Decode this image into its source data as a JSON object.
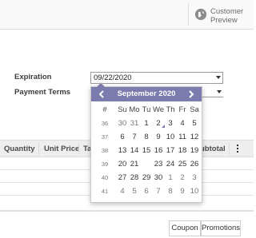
{
  "header": {
    "customer_preview_line1": "Customer",
    "customer_preview_line2": "Preview",
    "icon": "globe-icon"
  },
  "form": {
    "expiration_label": "Expiration",
    "expiration_value": "09/22/2020",
    "payment_terms_label": "Payment Terms",
    "payment_terms_value": ""
  },
  "datepicker": {
    "title": "September 2020",
    "week_header": "#",
    "day_headers": [
      "Su",
      "Mo",
      "Tu",
      "We",
      "Th",
      "Fr",
      "Sa"
    ],
    "weeks": [
      {
        "wk": "36",
        "days": [
          "30",
          "31",
          "1",
          "2",
          "3",
          "4",
          "5"
        ]
      },
      {
        "wk": "37",
        "days": [
          "6",
          "7",
          "8",
          "9",
          "10",
          "11",
          "12"
        ]
      },
      {
        "wk": "38",
        "days": [
          "13",
          "14",
          "15",
          "16",
          "17",
          "18",
          "19"
        ]
      },
      {
        "wk": "39",
        "days": [
          "20",
          "21",
          "22",
          "23",
          "24",
          "25",
          "26"
        ]
      },
      {
        "wk": "40",
        "days": [
          "27",
          "28",
          "29",
          "30",
          "1",
          "2",
          "3"
        ]
      },
      {
        "wk": "41",
        "days": [
          "4",
          "5",
          "6",
          "7",
          "8",
          "9",
          "10"
        ]
      }
    ],
    "selected": "22",
    "today": "2",
    "accent_color": "#7c7bad"
  },
  "table": {
    "columns": [
      "Quantity",
      "Unit Price",
      "Ta",
      "ubtotal"
    ]
  },
  "buttons": {
    "coupon": "Coupon",
    "promotions": "Promotions"
  }
}
